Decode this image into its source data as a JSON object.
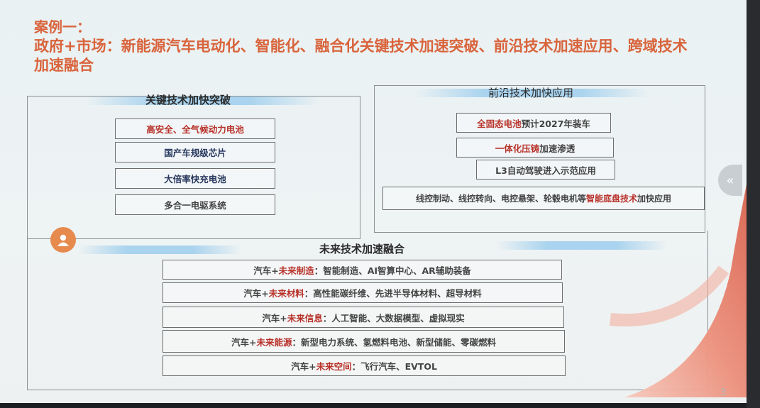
{
  "title_line1": "案例一：",
  "title_line2": "政府+市场：新能源汽车电动化、智能化、融合化关键技术加速突破、前沿技术加速应用、跨域技术加速融合",
  "key_tech": {
    "heading": "关键技术加快突破",
    "items": [
      {
        "prefix": "高安全、全气候动力电池",
        "suffix": ""
      },
      {
        "prefix": "国产车规级芯片",
        "suffix": ""
      },
      {
        "prefix": "大倍率快充电池",
        "suffix": ""
      },
      {
        "prefix": "多合一电驱系统",
        "suffix": ""
      }
    ]
  },
  "frontier": {
    "heading": "前沿技术加快应用",
    "items": [
      {
        "a": "全固态电池",
        "b": "预计2027年装车"
      },
      {
        "a": "一体化压铸",
        "b": "加速渗透"
      },
      {
        "a": "L3自动驾驶",
        "b": "进入示范应用"
      },
      {
        "a": "线控制动、线控转向、电控悬架、轮毂电机等",
        "b": "智能底盘技术",
        "c": "加快应用"
      }
    ]
  },
  "future": {
    "heading": "未来技术加速融合",
    "items": [
      {
        "a": "汽车+",
        "b": "未来制造",
        "c": "：智能制造、AI智算中心、AR辅助装备"
      },
      {
        "a": "汽车+",
        "b": "未来材料",
        "c": "：高性能碳纤维、先进半导体材料、超导材料"
      },
      {
        "a": "汽车+",
        "b": "未来信息",
        "c": "：人工智能、大数据模型、虚拟现实"
      },
      {
        "a": "汽车+",
        "b": "未来能源",
        "c": "：新型电力系统、氢燃料电池、新型储能、零碳燃料"
      },
      {
        "a": "汽车+",
        "b": "未来空间",
        "c": "：飞行汽车、EVTOL"
      }
    ]
  },
  "collapse_icon": "«",
  "page_number": "3",
  "icons": {
    "avatar": "user-avatar-icon",
    "collapse": "double-chevron-left-icon"
  },
  "colors": {
    "accent": "#d9643c",
    "red_text": "#b8322a",
    "heading_bar": "#a9d3ee"
  }
}
